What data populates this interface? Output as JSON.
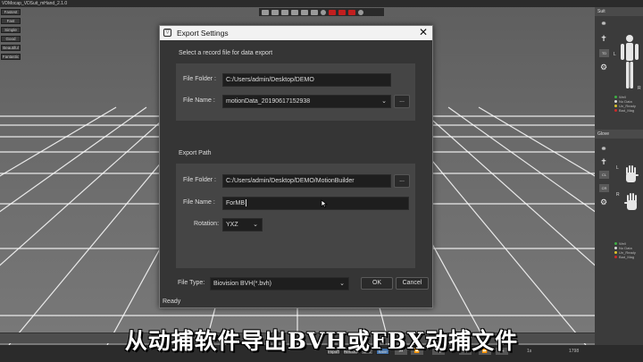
{
  "app": {
    "title": "VDMocap_VDSuit_mHand_2.1.0"
  },
  "quality_buttons": [
    "Fastest",
    "Fast",
    "Simple",
    "Good",
    "Beautiful",
    "Fantastic"
  ],
  "right_panel": {
    "suit": {
      "title": "Suit",
      "chip": "TD",
      "side_l": "L",
      "side_r": "R",
      "legend": [
        "Well",
        "No Data",
        "Un_Ready",
        "Bad_Mag"
      ]
    },
    "glove": {
      "title": "Glove",
      "chips": [
        "CL",
        "CR"
      ],
      "side_l": "L",
      "side_r": "R",
      "legend": [
        "Well",
        "No Data",
        "Un_Ready",
        "Bad_Mag"
      ]
    }
  },
  "colors": {
    "well": "#3cb043",
    "no_data": "#d8d8d8",
    "un_ready": "#d9c22b",
    "bad_mag": "#cc2a2a",
    "toolbar_red": "#c21f1f"
  },
  "dialog": {
    "title": "Export Settings",
    "record_section": "Select a record file for data export",
    "record_folder_label": "File Folder :",
    "record_folder_value": "C:/Users/admin/Desktop/DEMO",
    "record_name_label": "File Name :",
    "record_name_value": "motionData_20190617152938",
    "browse_label": "...",
    "export_path_section": "Export Path",
    "export_folder_label": "File Folder :",
    "export_folder_value": "C:/Users/admin/Desktop/DEMO/MotionBuilder",
    "export_name_label": "File Name :",
    "export_name_value": "ForMB",
    "rotation_label": "Rotation:",
    "rotation_value": "YXZ",
    "file_type_label": "File Type:",
    "file_type_value": "Biovision BVH(*.bvh)",
    "ok_label": "OK",
    "cancel_label": "Cancel",
    "status": "Ready"
  },
  "bottom_bar": {
    "buttons": [
      "Import",
      "Remove",
      "Edit",
      "Save"
    ],
    "active_button": "Save",
    "frame_start": "1s",
    "frame_end": "1798"
  },
  "caption": "从动捕软件导出BVH或FBX动捕文件"
}
